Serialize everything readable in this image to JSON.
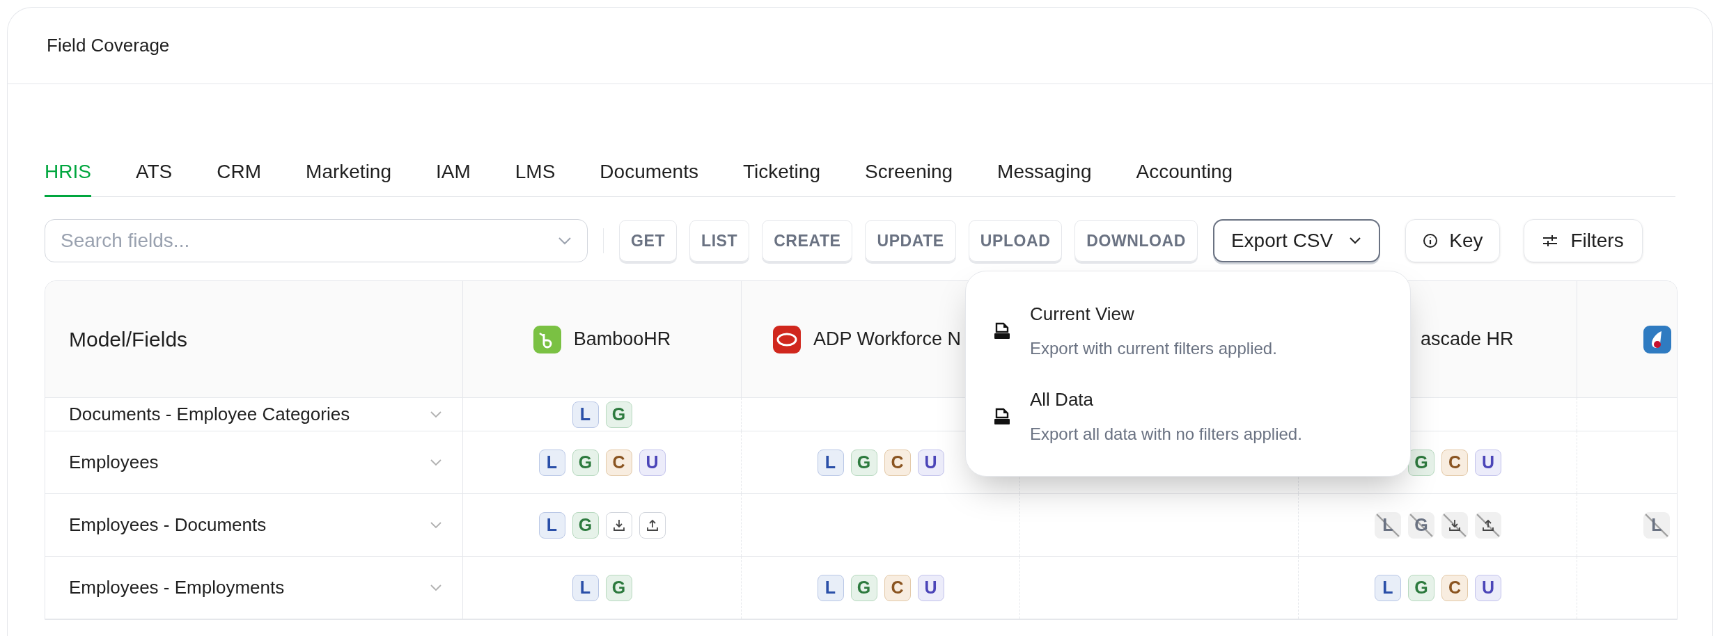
{
  "card": {
    "title": "Field Coverage"
  },
  "tabs": [
    {
      "label": "HRIS",
      "selected": true
    },
    {
      "label": "ATS",
      "selected": false
    },
    {
      "label": "CRM",
      "selected": false
    },
    {
      "label": "Marketing",
      "selected": false
    },
    {
      "label": "IAM",
      "selected": false
    },
    {
      "label": "LMS",
      "selected": false
    },
    {
      "label": "Documents",
      "selected": false
    },
    {
      "label": "Ticketing",
      "selected": false
    },
    {
      "label": "Screening",
      "selected": false
    },
    {
      "label": "Messaging",
      "selected": false
    },
    {
      "label": "Accounting",
      "selected": false
    }
  ],
  "search": {
    "placeholder": "Search fields..."
  },
  "operation_buttons": [
    "GET",
    "LIST",
    "CREATE",
    "UPDATE",
    "UPLOAD",
    "DOWNLOAD"
  ],
  "export_button": {
    "label": "Export CSV",
    "expanded": true
  },
  "key_button": {
    "label": "Key"
  },
  "filters_button": {
    "label": "Filters"
  },
  "export_menu": [
    {
      "title": "Current View",
      "description": "Export with current filters applied."
    },
    {
      "title": "All Data",
      "description": "Export all data with no filters applied."
    }
  ],
  "table": {
    "header": "Model/Fields",
    "providers": [
      {
        "name": "BambooHR",
        "kind": "bamboo"
      },
      {
        "name": "ADP Workforce N",
        "kind": "adp"
      },
      {
        "name": "ascade HR",
        "kind": "plain"
      },
      {
        "kind": "drop"
      }
    ],
    "rows": [
      {
        "label": "Documents - Employee Categories",
        "cells": [
          [
            {
              "kind": "list",
              "label": "L",
              "disabled": false
            },
            {
              "kind": "get",
              "label": "G",
              "disabled": false
            }
          ],
          [],
          [],
          [],
          []
        ]
      },
      {
        "label": "Employees",
        "cells": [
          [
            {
              "kind": "list",
              "label": "L",
              "disabled": false
            },
            {
              "kind": "get",
              "label": "G",
              "disabled": false
            },
            {
              "kind": "create",
              "label": "C",
              "disabled": false
            },
            {
              "kind": "update",
              "label": "U",
              "disabled": false
            }
          ],
          [
            {
              "kind": "list",
              "label": "L",
              "disabled": false
            },
            {
              "kind": "get",
              "label": "G",
              "disabled": false
            },
            {
              "kind": "create",
              "label": "C",
              "disabled": false
            },
            {
              "kind": "update",
              "label": "U",
              "disabled": false
            }
          ],
          [],
          [
            {
              "kind": "get",
              "label": "G",
              "disabled": false
            },
            {
              "kind": "create",
              "label": "C",
              "disabled": false
            },
            {
              "kind": "update",
              "label": "U",
              "disabled": false
            }
          ],
          []
        ]
      },
      {
        "label": "Employees - Documents",
        "cells": [
          [
            {
              "kind": "list",
              "label": "L",
              "disabled": false
            },
            {
              "kind": "get",
              "label": "G",
              "disabled": false
            },
            {
              "kind": "download",
              "disabled": false
            },
            {
              "kind": "upload",
              "disabled": false
            }
          ],
          [],
          [],
          [
            {
              "kind": "list",
              "label": "L",
              "disabled": true
            },
            {
              "kind": "get",
              "label": "G",
              "disabled": true
            },
            {
              "kind": "download",
              "disabled": true
            },
            {
              "kind": "upload",
              "disabled": true
            }
          ],
          [
            {
              "kind": "list",
              "label": "L",
              "disabled": true
            }
          ]
        ]
      },
      {
        "label": "Employees - Employments",
        "cells": [
          [
            {
              "kind": "list",
              "label": "L",
              "disabled": false
            },
            {
              "kind": "get",
              "label": "G",
              "disabled": false
            }
          ],
          [
            {
              "kind": "list",
              "label": "L",
              "disabled": false
            },
            {
              "kind": "get",
              "label": "G",
              "disabled": false
            },
            {
              "kind": "create",
              "label": "C",
              "disabled": false
            },
            {
              "kind": "update",
              "label": "U",
              "disabled": false
            }
          ],
          [],
          [
            {
              "kind": "list",
              "label": "L",
              "disabled": false
            },
            {
              "kind": "get",
              "label": "G",
              "disabled": false
            },
            {
              "kind": "create",
              "label": "C",
              "disabled": false
            },
            {
              "kind": "update",
              "label": "U",
              "disabled": false
            }
          ],
          []
        ]
      }
    ]
  }
}
